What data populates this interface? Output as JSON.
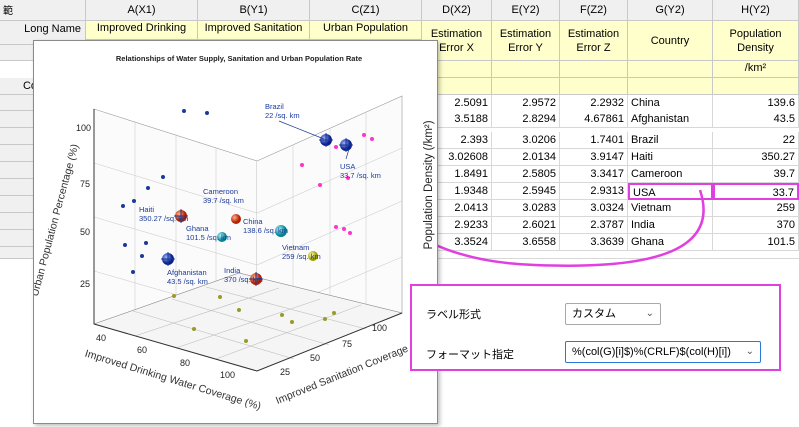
{
  "sheet": {
    "corner_glyph": "範",
    "columns": [
      "A(X1)",
      "B(Y1)",
      "C(Z1)",
      "D(X2)",
      "E(Y2)",
      "F(Z2)",
      "G(Y2)",
      "H(Y2)"
    ],
    "row_labels": {
      "long_name": "Long Name",
      "comments": "Co"
    },
    "long_names": {
      "a": "Improved Drinking",
      "b": "Improved Sanitation",
      "c": "Urban Population",
      "d": "Estimation Error X",
      "e": "Estimation Error Y",
      "f": "Estimation Error Z",
      "g": "Country",
      "h": "Population Density"
    },
    "units_h": "/km²",
    "rows": [
      [
        "2.5091",
        "2.9572",
        "2.2932",
        "China",
        "139.6"
      ],
      [
        "3.5188",
        "2.8294",
        "4.67861",
        "Afghanistan",
        "43.5"
      ],
      [
        "2.393",
        "3.0206",
        "1.7401",
        "Brazil",
        "22"
      ],
      [
        "3.02608",
        "2.0134",
        "3.9147",
        "Haiti",
        "350.27"
      ],
      [
        "1.8491",
        "2.5805",
        "3.3417",
        "Cameroon",
        "39.7"
      ],
      [
        "1.9348",
        "2.5945",
        "2.9313",
        "USA",
        "33.7"
      ],
      [
        "2.0413",
        "3.0283",
        "3.0324",
        "Vietnam",
        "259"
      ],
      [
        "2.9233",
        "2.6021",
        "2.3787",
        "India",
        "370"
      ],
      [
        "3.3524",
        "3.6558",
        "3.3639",
        "Ghana",
        "101.5"
      ]
    ]
  },
  "graph": {
    "title": "Relationships of Water Supply, Sanitation and Urban Population Rate",
    "z_axis_title": "Urban Population Percentage (%)",
    "x_axis_title": "Improved Drinking Water Coverage (%)",
    "y_axis_title": "Improved Sanitation Coverage (%)",
    "right_axis_title": "Population Density (/km²)",
    "z_ticks": [
      "100",
      "75",
      "50",
      "25"
    ],
    "x_ticks": [
      "40",
      "60",
      "80",
      "100"
    ],
    "y_ticks": [
      "100",
      "75",
      "50",
      "25"
    ],
    "labels": [
      {
        "name": "Brazil",
        "density": "22 /sq. km"
      },
      {
        "name": "USA",
        "density": "33.7 /sq. km"
      },
      {
        "name": "Cameroon",
        "density": "39.7 /sq. km"
      },
      {
        "name": "Haiti",
        "density": "350.27 /sq. km"
      },
      {
        "name": "China",
        "density": "138.6 /sq. km"
      },
      {
        "name": "Ghana",
        "density": "101.5 /sq. km"
      },
      {
        "name": "Vietnam",
        "density": "259 /sq. km"
      },
      {
        "name": "Afghanistan",
        "density": "43.5 /sq. km"
      },
      {
        "name": "India",
        "density": "370 /sq. km"
      }
    ]
  },
  "dialog": {
    "label_format_label": "ラベル形式",
    "label_format_value": "カスタム",
    "format_spec_label": "フォーマット指定",
    "format_spec_value": "%(col(G)[i]$)%(CRLF)$(col(H)[i])"
  },
  "colors": {
    "accent": "#e040e0",
    "header_bg": "#f0f0f0",
    "meta_bg": "#ffffcc",
    "label_text": "#1a3a9a",
    "drop_point": "#ff33cc",
    "floor_point": "#9a9a2a"
  }
}
